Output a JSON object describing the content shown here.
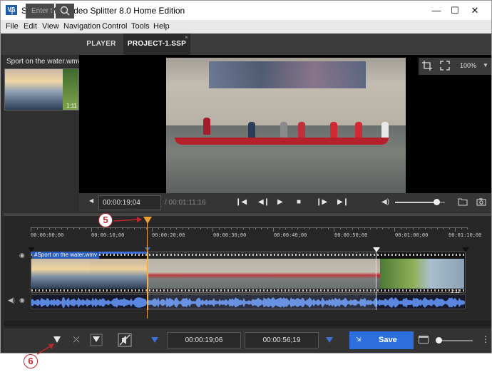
{
  "window": {
    "title": "SolveigMM Video Splitter 8.0 Home Edition",
    "icon_text": "VS",
    "controls": {
      "minimize": "—",
      "maximize": "☐",
      "close": "✕"
    }
  },
  "menu": {
    "items": [
      "File",
      "Edit",
      "View",
      "Navigation",
      "Control",
      "Tools",
      "Help"
    ]
  },
  "toolbar": {
    "add_label": "+",
    "search_placeholder": "Enter t",
    "tabs": [
      {
        "label": "PLAYER"
      },
      {
        "label": "PROJECT-1.SSP"
      }
    ],
    "tab_close": "×"
  },
  "media_panel": {
    "file_name": "Sport on the water.wmv",
    "thumb_duration": "1:11"
  },
  "viewer": {
    "zoom": "100%"
  },
  "player_controls": {
    "current_time": "00:00:19;04",
    "total_time": "/ 00:01:11;16",
    "volume_level": 0.83
  },
  "timeline": {
    "ticks": [
      "00:00:00;00",
      "00:00:10;00",
      "00:00:20;00",
      "00:00:30;00",
      "00:00:40;00",
      "00:00:50;00",
      "00:01:00;00",
      "00:01:10;00"
    ],
    "clip_label": "#Sport on the water.wmv",
    "clip_duration": "1:11"
  },
  "bottom": {
    "start_time": "00:00:19;06",
    "end_time": "00:00:56;19",
    "save_label": "Save",
    "zoom_level": 0.05
  },
  "callouts": [
    {
      "number": "5"
    },
    {
      "number": "6"
    }
  ],
  "colors": {
    "accent": "#2d6fdc",
    "playhead": "#f0a030",
    "callout": "#c0272d"
  }
}
